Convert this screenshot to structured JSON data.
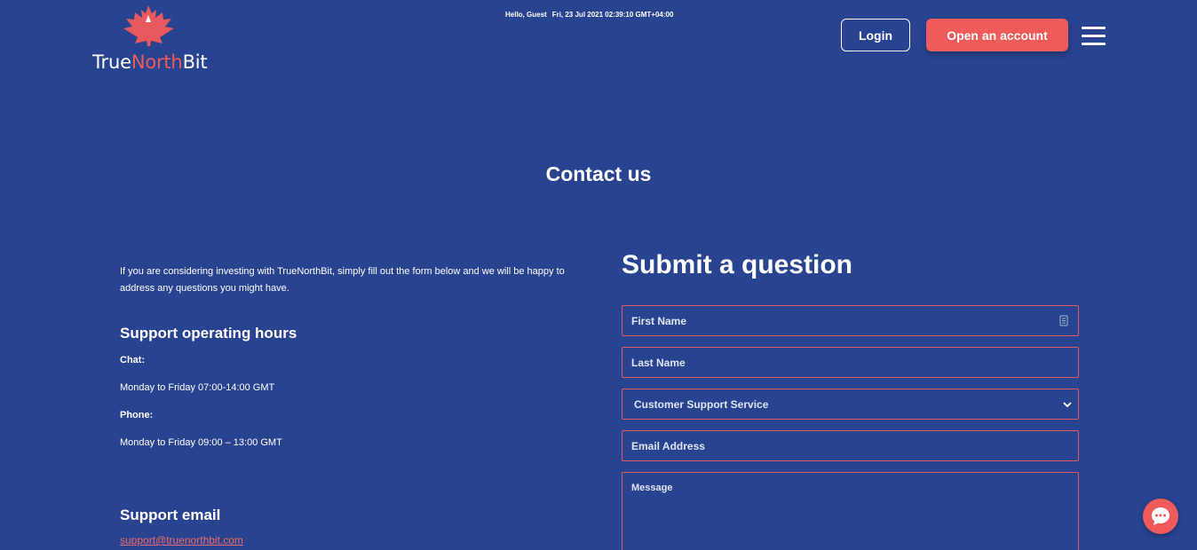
{
  "header": {
    "logo": {
      "part1": "True",
      "part2": "North",
      "part3": "Bit"
    },
    "greeting": "Hello, Guest",
    "datetime": "Fri, 23 Jul 2021 02:39:10 GMT+04:00",
    "login_label": "Login",
    "open_account_label": "Open an account",
    "menu_icon": "hamburger-menu-icon"
  },
  "page": {
    "title": "Contact us"
  },
  "info": {
    "intro": "If you are considering investing with TrueNorthBit, simply fill out the form below and we will be happy to address any questions you might have.",
    "hours_heading": "Support operating hours",
    "chat_label": "Chat:",
    "chat_hours": "Monday to Friday 07:00-14:00 GMT",
    "phone_label": "Phone:",
    "phone_hours": "Monday to Friday 09:00 – 13:00 GMT",
    "email_heading": "Support email",
    "email": "support@truenorthbit.com"
  },
  "form": {
    "title": "Submit a question",
    "first_name_placeholder": "First Name",
    "last_name_placeholder": "Last Name",
    "department_selected": "Customer Support Service",
    "email_placeholder": "Email Address",
    "message_placeholder": "Message"
  },
  "colors": {
    "background": "#28438f",
    "accent": "#ef5a5a",
    "field_border": "#e05a5e"
  },
  "chat_widget": {
    "icon": "chat-bubble-icon"
  }
}
